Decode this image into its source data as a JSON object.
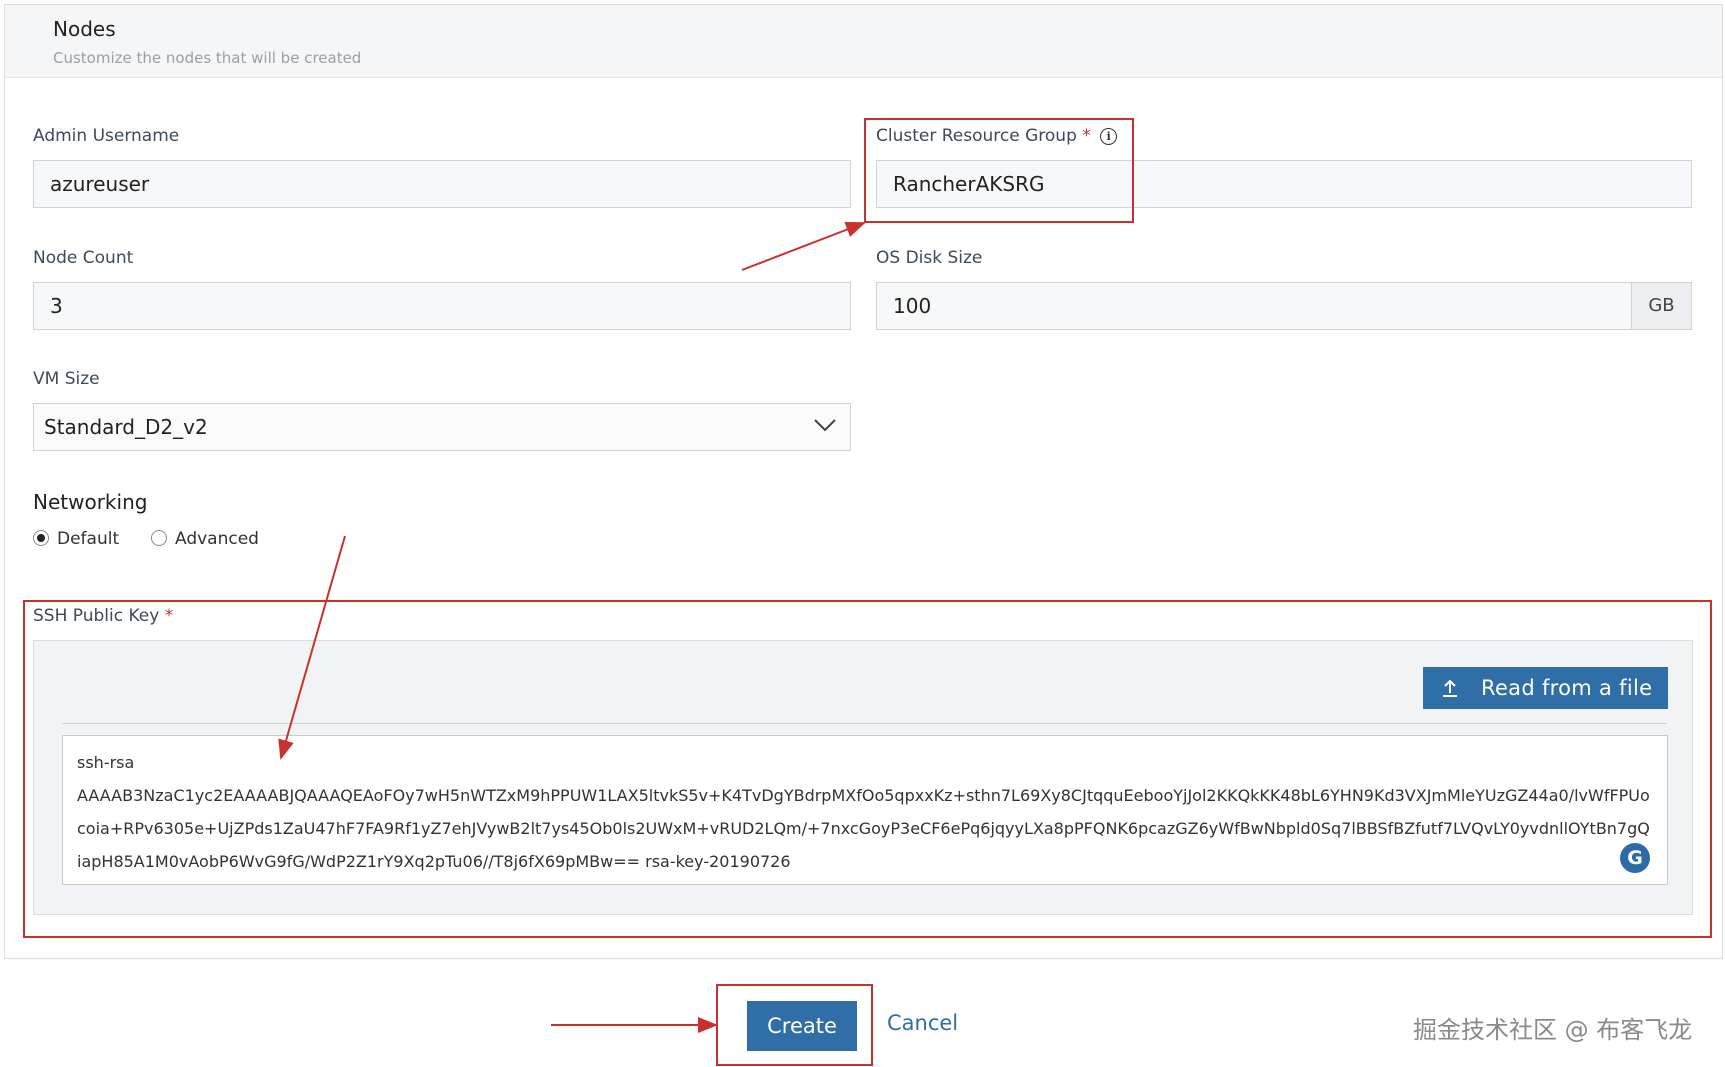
{
  "section": {
    "title": "Nodes",
    "subtitle": "Customize the nodes that will be created"
  },
  "fields": {
    "admin_username": {
      "label": "Admin Username",
      "value": "azureuser"
    },
    "resource_group": {
      "label": "Cluster Resource Group",
      "required_mark": "*",
      "info_icon": "i",
      "value": "RancherAKSRG"
    },
    "node_count": {
      "label": "Node Count",
      "value": "3"
    },
    "os_disk_size": {
      "label": "OS Disk Size",
      "value": "100",
      "unit": "GB"
    },
    "vm_size": {
      "label": "VM Size",
      "value": "Standard_D2_v2"
    }
  },
  "networking": {
    "title": "Networking",
    "options": [
      "Default",
      "Advanced"
    ],
    "selected": "Default"
  },
  "ssh": {
    "label": "SSH Public Key",
    "required_mark": "*",
    "read_button": "Read from a file",
    "line1": "ssh-rsa",
    "key": "AAAAB3NzaC1yc2EAAAABJQAAAQEAoFOy7wH5nWTZxM9hPPUW1LAX5ltvkS5v+K4TvDgYBdrpMXfOo5qpxxKz+sthn7L69Xy8CJtqquEebooYjJol2KKQkKK48bL6YHN9Kd3VXJmMleYUzGZ44a0/lvWfFPUocoia+RPv6305e+UjZPds1ZaU47hF7FA9Rf1yZ7ehJVywB2lt7ys45Ob0ls2UWxM+vRUD2LQm/+7nxcGoyP3eCF6ePq6jqyyLXa8pPFQNK6pcazGZ6yWfBwNbpld0Sq7lBBSfBZfutf7LVQvLY0yvdnllOYtBn7gQiapH85A1M0vAobP6WvG9fG/WdP2Z1rY9Xq2pTu06//T8j6fX69pMBw== rsa-key-20190726",
    "grammar_icon": "G"
  },
  "actions": {
    "create": "Create",
    "cancel": "Cancel"
  },
  "watermark": "掘金技术社区 @ 布客飞龙",
  "colors": {
    "primary": "#2f6ea7",
    "highlight": "#c8312e"
  }
}
